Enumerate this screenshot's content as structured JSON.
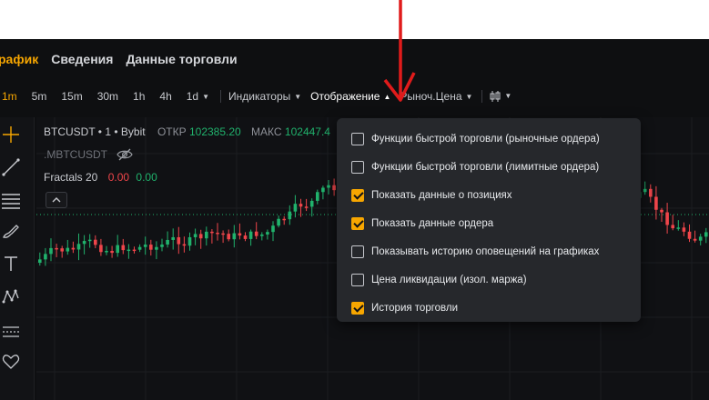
{
  "tabs": [
    {
      "label": "рафик",
      "active": true
    },
    {
      "label": "Сведения",
      "active": false
    },
    {
      "label": "Данные торговли",
      "active": false
    }
  ],
  "toolbar": {
    "timeframes": [
      {
        "label": "1m",
        "active": true
      },
      {
        "label": "5m",
        "active": false
      },
      {
        "label": "15m",
        "active": false
      },
      {
        "label": "30m",
        "active": false
      },
      {
        "label": "1h",
        "active": false
      },
      {
        "label": "4h",
        "active": false
      },
      {
        "label": "1d",
        "active": false
      }
    ],
    "indicators_label": "Индикаторы",
    "display_label": "Отображение",
    "price_type_label": "Рыноч.Цена"
  },
  "legend": {
    "symbol": "BTCUSDT",
    "interval": "1",
    "exchange": "Bybit",
    "open_label": "ОТКР",
    "open_value": "102385.20",
    "high_label": "МАКС",
    "high_value": "102447.4",
    "overlay_symbol": ".MBTCUSDT",
    "indicator_name": "Fractals 20",
    "indicator_values": [
      "0.00",
      "0.00"
    ]
  },
  "menu": {
    "items": [
      {
        "label": "Функции быстрой торговли (рыночные ордера)",
        "checked": false
      },
      {
        "label": "Функции быстрой торговли (лимитные ордера)",
        "checked": false
      },
      {
        "label": "Показать данные о позициях",
        "checked": true
      },
      {
        "label": "Показать данные ордера",
        "checked": true
      },
      {
        "label": "Показывать историю оповещений на графиках",
        "checked": false
      },
      {
        "label": "Цена ликвидации (изол. маржа)",
        "checked": false
      },
      {
        "label": "История торговли",
        "checked": true
      }
    ]
  },
  "colors": {
    "accent": "#f7a600",
    "up": "#20b26c",
    "down": "#ef454a",
    "annotation_arrow": "#e01b1b"
  },
  "icons": {
    "crosshair": "crosshair-icon",
    "trend_line": "trend-line-icon",
    "fib": "fib-retracement-icon",
    "brush": "brush-icon",
    "text": "text-tool-icon",
    "pattern": "pattern-icon",
    "forecast": "forecast-icon",
    "favorite": "heart-icon",
    "hide": "eye-off-icon",
    "chart_type": "candles-icon"
  }
}
